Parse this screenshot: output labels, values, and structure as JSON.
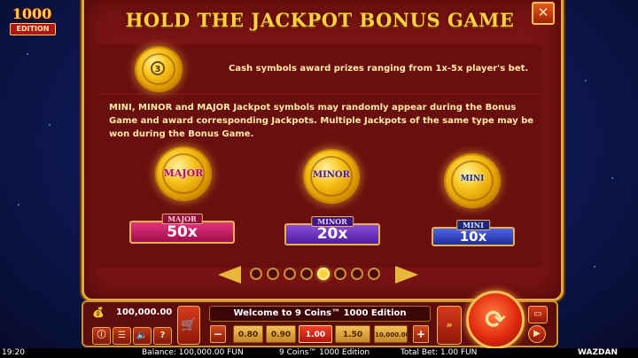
{
  "logo": {
    "number": "1000",
    "edition": "EDITION"
  },
  "title": "HOLD THE JACKPOT BONUS GAME",
  "close_label": "✕",
  "cash": {
    "coin_badge": "3",
    "text": "Cash symbols award prizes ranging from 1x-5x player's bet."
  },
  "jackpot_description": "MINI, MINOR and MAJOR Jackpot symbols may randomly appear during the Bonus Game and award corresponding Jackpots. Multiple Jackpots of the same type may be won during the Bonus Game.",
  "jackpots": {
    "major": {
      "coin_label": "MAJOR",
      "caption": "MAJOR",
      "value": "50x"
    },
    "minor": {
      "coin_label": "MINOR",
      "caption": "MINOR",
      "value": "20x"
    },
    "mini": {
      "coin_label": "MINI",
      "caption": "MINI",
      "value": "10x"
    }
  },
  "pagination": {
    "total": 8,
    "active_index": 4
  },
  "controls": {
    "balance": "100,000.00",
    "message": "Welcome to 9 Coins™ 1000 Edition",
    "info_icon": "ⓘ",
    "menu_icon": "☰",
    "sound_icon": "🔈",
    "help_icon": "?",
    "minus": "−",
    "plus": "+",
    "stakes": [
      "0.80",
      "0.90",
      "1.00",
      "1.50",
      "10,000.00"
    ],
    "selected_stake_index": 2,
    "turbo_label": "»",
    "spin_icon": "⟳"
  },
  "status_bar": {
    "time": "19:20",
    "balance": "Balance: 100,000.00 FUN",
    "game": "9 Coins™ 1000 Edition",
    "total_bet": "Total Bet: 1.00 FUN",
    "brand": "WAZDAN"
  }
}
